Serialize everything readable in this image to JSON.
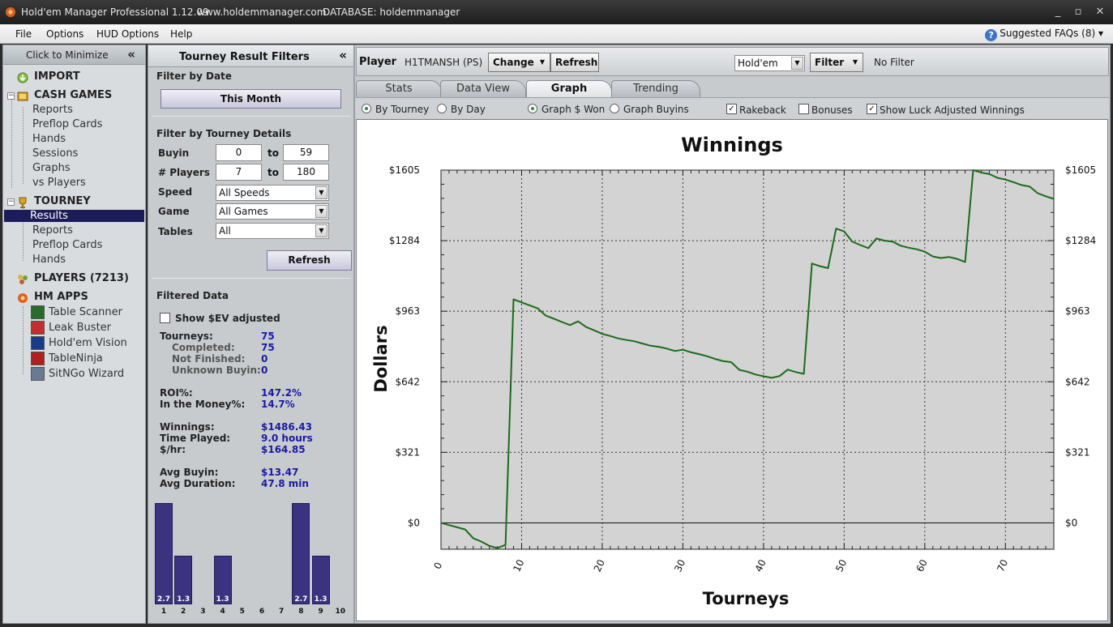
{
  "app": {
    "title": "Hold'em Manager Professional 1.12.09",
    "website": "www.holdemmanager.com",
    "database": "DATABASE: holdemmanager"
  },
  "menu": {
    "items": [
      {
        "label": "File"
      },
      {
        "label": "Options"
      },
      {
        "label": "HUD Options"
      },
      {
        "label": "Help"
      }
    ],
    "faq_label": "Suggested FAQs (8)",
    "faq_arrow": "▾"
  },
  "leftnav": {
    "minimize_label": "Click to Minimize",
    "minimize_icon": "«",
    "import_label": "IMPORT",
    "cash_label": "CASH GAMES",
    "cash_items": [
      {
        "label": "Reports"
      },
      {
        "label": "Preflop Cards"
      },
      {
        "label": "Hands"
      },
      {
        "label": "Sessions"
      },
      {
        "label": "Graphs"
      },
      {
        "label": "vs Players"
      }
    ],
    "tourney_label": "TOURNEY",
    "tourney_items": [
      {
        "label": "Results"
      },
      {
        "label": "Reports"
      },
      {
        "label": "Preflop Cards"
      },
      {
        "label": "Hands"
      }
    ],
    "players_label": "PLAYERS (7213)",
    "hmapps_label": "HM APPS",
    "apps": [
      {
        "label": "Table Scanner"
      },
      {
        "label": "Leak Buster"
      },
      {
        "label": "Hold'em Vision"
      },
      {
        "label": "TableNinja"
      },
      {
        "label": "SitNGo Wizard"
      }
    ]
  },
  "filters": {
    "header": "Tourney Result Filters",
    "collapse_icon": "«",
    "by_date_title": "Filter by Date",
    "date_button": "This Month",
    "details_title": "Filter by Tourney Details",
    "buyin_label": "Buyin",
    "buyin_from": "0",
    "buyin_to": "59",
    "players_label": "# Players",
    "players_from": "7",
    "players_to": "180",
    "to_label": "to",
    "speed_label": "Speed",
    "speed_value": "All Speeds",
    "game_label": "Game",
    "game_value": "All Games",
    "tables_label": "Tables",
    "tables_value": "All",
    "refresh_label": "Refresh",
    "filtered_title": "Filtered Data",
    "ev_label": "Show $EV adjusted",
    "stats": {
      "tourneys_label": "Tourneys:",
      "tourneys": "75",
      "completed_label": "Completed:",
      "completed": "75",
      "notfinished_label": "Not Finished:",
      "notfinished": "0",
      "unknown_label": "Unknown Buyin:",
      "unknown": "0",
      "roi_label": "ROI%:",
      "roi": "147.2%",
      "itm_label": "In the Money%:",
      "itm": "14.7%",
      "winnings_label": "Winnings:",
      "winnings": "$1486.43",
      "time_label": "Time Played:",
      "time": "9.0  hours",
      "hr_label": "$/hr:",
      "hr": "$164.85",
      "avgbuyin_label": "Avg Buyin:",
      "avgbuyin": "$13.47",
      "avgdur_label": "Avg Duration:",
      "avgdur": "47.8  min"
    },
    "histogram": {
      "labels": [
        "1",
        "2",
        "3",
        "4",
        "5",
        "6",
        "7",
        "8",
        "9",
        "10"
      ],
      "values": [
        2.7,
        1.3,
        0,
        1.3,
        0,
        0,
        0,
        2.7,
        1.3,
        0
      ],
      "value_labels": [
        "2.7",
        "1.3",
        "",
        "1.3",
        "",
        "",
        "",
        "2.7",
        "1.3",
        ""
      ]
    }
  },
  "main": {
    "player_label": "Player",
    "player_name": "H1TMANSH (PS)",
    "change_label": "Change",
    "refresh_label": "Refresh",
    "game_select": "Hold'em",
    "filter_label": "Filter",
    "no_filter": "No Filter",
    "tabs": [
      {
        "label": "Stats"
      },
      {
        "label": "Data View"
      },
      {
        "label": "Graph"
      },
      {
        "label": "Trending"
      }
    ],
    "options": {
      "by_tourney": "By Tourney",
      "by_day": "By Day",
      "graph_won": "Graph $ Won",
      "graph_buyins": "Graph Buyins",
      "rakeback": "Rakeback",
      "bonuses": "Bonuses",
      "luck": "Show Luck Adjusted Winnings"
    }
  },
  "chart_data": {
    "type": "line",
    "title": "Winnings",
    "xlabel": "Tourneys",
    "ylabel": "Dollars",
    "xlim": [
      0,
      76
    ],
    "ylim": [
      -120,
      1605
    ],
    "x_ticks": [
      0,
      10,
      20,
      30,
      40,
      50,
      60,
      70
    ],
    "y_ticks": [
      0,
      321,
      642,
      963,
      1284,
      1605
    ],
    "y_tick_labels": [
      "$0",
      "$321",
      "$642",
      "$963",
      "$1284",
      "$1605"
    ],
    "grid": true,
    "color": "#1a6b1a",
    "series": [
      {
        "x": [
          0,
          1,
          2,
          3,
          4,
          5,
          6,
          7,
          8,
          9,
          10,
          11,
          12,
          13,
          14,
          15,
          16,
          17,
          18,
          19,
          20,
          21,
          22,
          23,
          24,
          25,
          26,
          27,
          28,
          29,
          30,
          31,
          32,
          33,
          34,
          35,
          36,
          37,
          38,
          39,
          40,
          41,
          42,
          43,
          44,
          45,
          46,
          47,
          48,
          49,
          50,
          51,
          52,
          53,
          54,
          55,
          56,
          57,
          58,
          59,
          60,
          61,
          62,
          63,
          64,
          65,
          66,
          67,
          68,
          69,
          70,
          71,
          72,
          73,
          74,
          75,
          76
        ],
        "y": [
          0,
          -10,
          -20,
          -30,
          -70,
          -85,
          -105,
          -115,
          -100,
          1017,
          1003,
          990,
          976,
          943,
          929,
          914,
          900,
          917,
          891,
          876,
          860,
          850,
          839,
          832,
          826,
          816,
          806,
          801,
          793,
          782,
          788,
          776,
          768,
          758,
          746,
          736,
          731,
          696,
          688,
          675,
          667,
          660,
          668,
          697,
          686,
          678,
          1180,
          1168,
          1159,
          1339,
          1326,
          1280,
          1264,
          1250,
          1294,
          1284,
          1280,
          1261,
          1252,
          1245,
          1234,
          1212,
          1205,
          1210,
          1201,
          1187,
          1605,
          1594,
          1587,
          1570,
          1562,
          1550,
          1537,
          1530,
          1500,
          1486,
          1474
        ]
      }
    ]
  }
}
